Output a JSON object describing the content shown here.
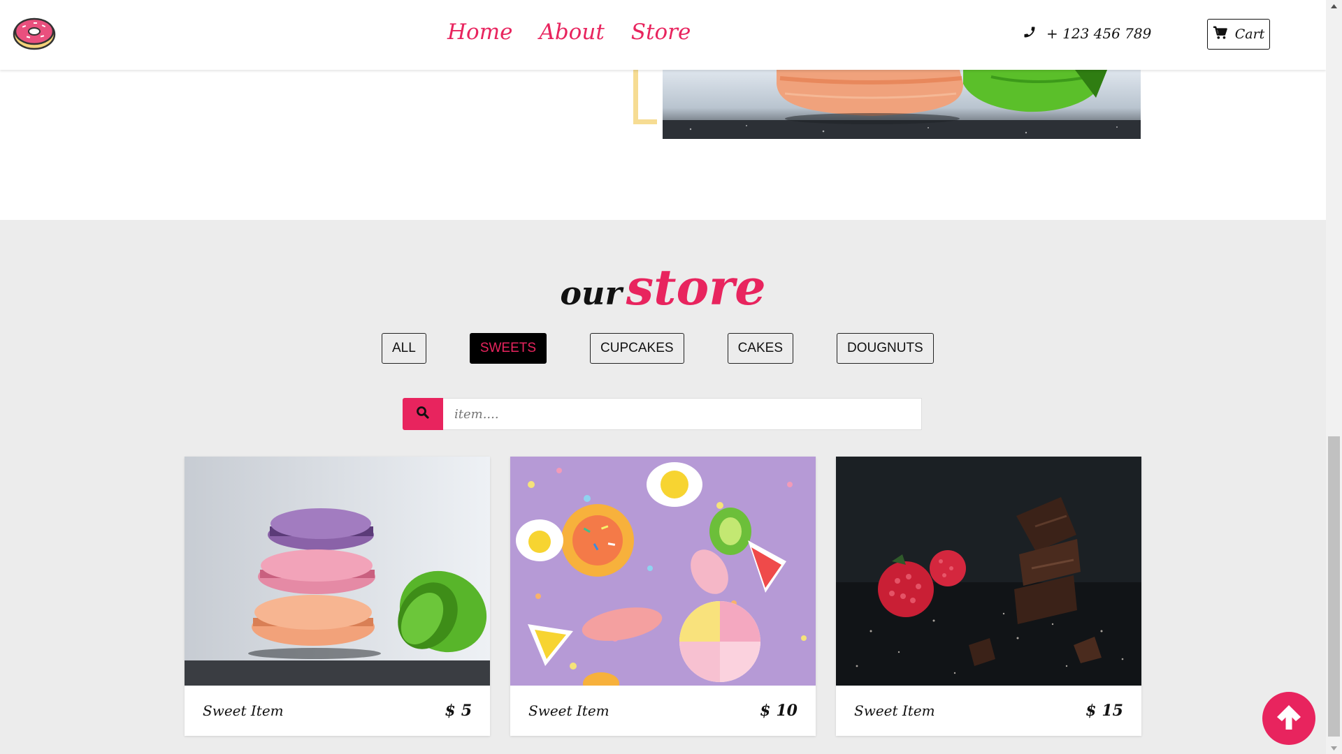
{
  "navbar": {
    "links": [
      "Home",
      "About",
      "Store"
    ],
    "phone": "+ 123 456 789",
    "cart_label": "Cart"
  },
  "store": {
    "title_small": "our",
    "title_large": "store",
    "filters": [
      "ALL",
      "SWEETS",
      "CUPCAKES",
      "CAKES",
      "DOUGNUTS"
    ],
    "active_filter": "SWEETS",
    "search_placeholder": "item....",
    "items": [
      {
        "name": "Sweet Item",
        "currency": "$",
        "price": "5"
      },
      {
        "name": "Sweet Item",
        "currency": "$",
        "price": "10"
      },
      {
        "name": "Sweet Item",
        "currency": "$",
        "price": "15"
      }
    ]
  },
  "colors": {
    "accent": "#e8245e",
    "section_bg": "#ececec",
    "frame_yellow": "#f6dc93"
  },
  "icons": [
    "donut-logo",
    "phone-icon",
    "cart-icon",
    "search-icon",
    "arrow-up-icon"
  ]
}
